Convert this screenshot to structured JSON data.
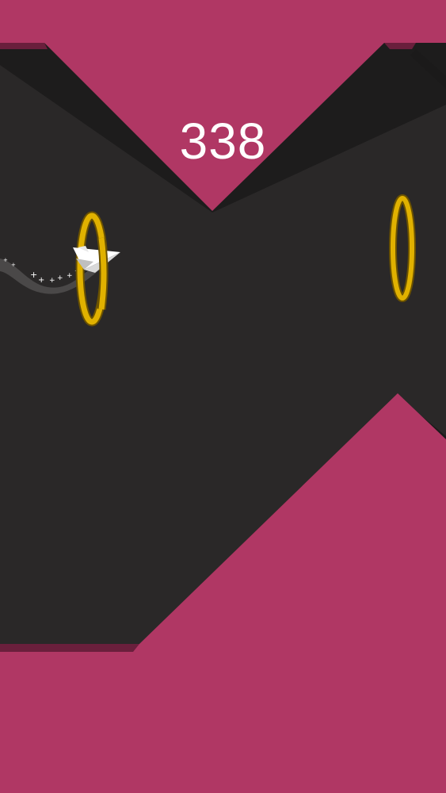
{
  "hud": {
    "score": "338"
  },
  "colors": {
    "background": "#2a2828",
    "wall": "#b03764",
    "wall_edge": "#6a1f3c",
    "wall_shadow": "#1b1a1a",
    "ring": "#e0b100",
    "ring_outline": "#6b5200",
    "plane": "#ffffff",
    "trail": "#4a4848"
  },
  "icons": {
    "player": "paper-plane-icon",
    "target": "gold-ring-icon"
  }
}
